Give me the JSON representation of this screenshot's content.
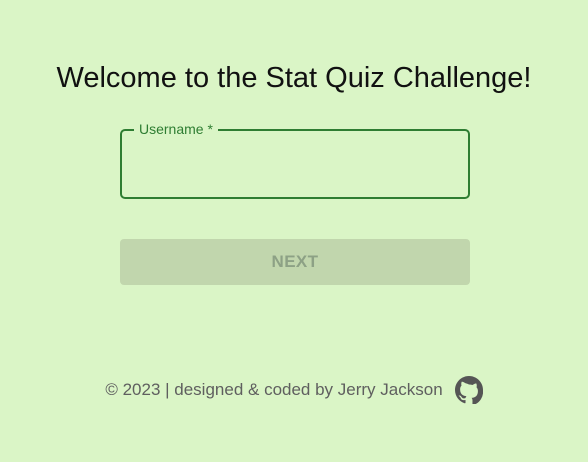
{
  "page": {
    "title": "Welcome to the Stat Quiz Challenge!"
  },
  "form": {
    "username_label": "Username *",
    "username_value": "",
    "next_label": "NEXT"
  },
  "footer": {
    "text": "© 2023 | designed & coded by Jerry Jackson",
    "github_icon": "github-icon"
  },
  "colors": {
    "background": "#daf5c6",
    "accent": "#2e7d32",
    "button_disabled_bg": "#c1d6ad",
    "button_disabled_text": "#8da185",
    "footer_text": "#5f5f5f"
  }
}
